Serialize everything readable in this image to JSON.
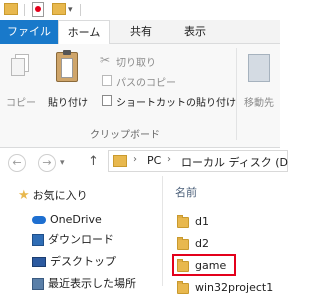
{
  "ribbon_tabs": [
    "ファイル",
    "ホーム",
    "共有",
    "表示"
  ],
  "ribbon": {
    "copy": "コピー",
    "paste": "貼り付け",
    "cut": "切り取り",
    "copy_path": "パスのコピー",
    "paste_shortcut": "ショートカットの貼り付け",
    "group_clipboard": "クリップボード",
    "move_to": "移動先"
  },
  "breadcrumb": {
    "pc": "PC",
    "drive": "ローカル ディスク (D"
  },
  "nav_pane": {
    "favorites": "お気に入り",
    "onedrive": "OneDrive",
    "downloads": "ダウンロード",
    "desktop": "デスクトップ",
    "recent": "最近表示した場所"
  },
  "file_list": {
    "column_name": "名前",
    "items": [
      "d1",
      "d2",
      "game",
      "win32project1"
    ]
  },
  "colors": {
    "file_tab": "#1979ca",
    "highlight": "#e3001b",
    "folder": "#e8b84e",
    "onedrive": "#1e6fd0"
  }
}
